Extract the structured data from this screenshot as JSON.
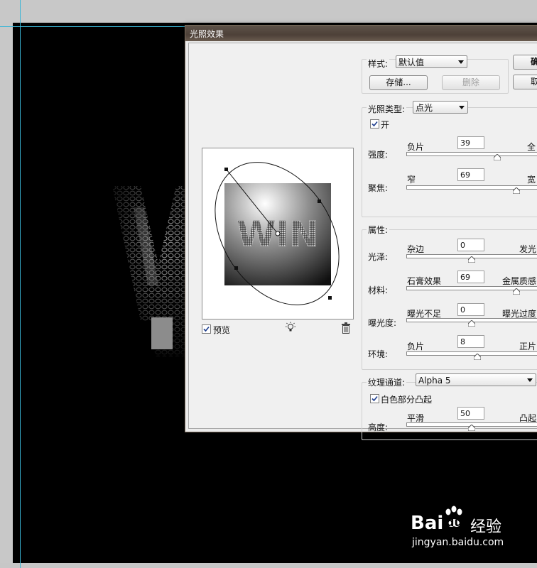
{
  "dialog": {
    "title": "光照效果",
    "ok_label": "确",
    "cancel_label": "取"
  },
  "style": {
    "label": "样式:",
    "value": "默认值",
    "save_label": "存储...",
    "delete_label": "删除"
  },
  "light_type": {
    "label": "光照类型:",
    "value": "点光",
    "on_label": "开",
    "on_checked": true,
    "intensity": {
      "label": "强度:",
      "min": "负片",
      "max": "全",
      "value": "39"
    },
    "focus": {
      "label": "聚焦:",
      "min": "窄",
      "max": "宽",
      "value": "69"
    }
  },
  "properties": {
    "label": "属性:",
    "gloss": {
      "label": "光泽:",
      "min": "杂边",
      "max": "发光",
      "value": "0"
    },
    "material": {
      "label": "材料:",
      "min": "石膏效果",
      "max": "金属质感",
      "value": "69"
    },
    "exposure": {
      "label": "曝光度:",
      "min": "曝光不足",
      "max": "曝光过度",
      "value": "0"
    },
    "ambience": {
      "label": "环境:",
      "min": "负片",
      "max": "正片",
      "value": "8"
    }
  },
  "texture": {
    "label": "纹理通道:",
    "channel": "Alpha 5",
    "white_is_high_label": "白色部分凸起",
    "white_is_high_checked": true,
    "height": {
      "label": "高度:",
      "min": "平滑",
      "max": "凸起",
      "value": "50"
    }
  },
  "preview": {
    "label": "预览",
    "checked": true,
    "preview_text": "WIN"
  },
  "watermark": {
    "brand": "Bai",
    "brand2": "du",
    "suffix": "经验",
    "url": "jingyan.baidu.com"
  },
  "colors": {
    "dialog_bg": "#f0f0f0",
    "title_bar": "#4d4038",
    "canvas": "#000000",
    "guide": "#3ab6d6"
  }
}
